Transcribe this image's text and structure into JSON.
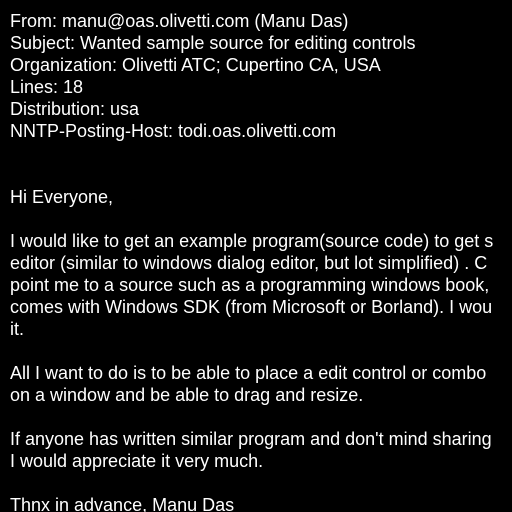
{
  "colors": {
    "background": "#000000",
    "text": "#ffffff"
  },
  "headers": {
    "from": "From: manu@oas.olivetti.com (Manu Das)",
    "subject": "Subject: Wanted sample source for editing controls",
    "organization": "Organization: Olivetti ATC; Cupertino CA, USA",
    "lines": "Lines: 18",
    "distribution": "Distribution: usa",
    "nntp_posting_host": "NNTP-Posting-Host: todi.oas.olivetti.com"
  },
  "body": {
    "greeting": "Hi Everyone,",
    "paragraph1": [
      "I would like to get an example program(source code) to get s",
      "editor (similar to windows dialog editor, but lot simplified) . C",
      "point me to a source such as a programming windows book,",
      "comes with Windows SDK (from Microsoft or Borland). I wou",
      "it."
    ],
    "paragraph2": [
      "All I want to do is to be able to place a edit control or combo",
      "on a window and be able to drag and resize."
    ],
    "paragraph3": [
      "If anyone has written similar program and don't mind sharing",
      "I would appreciate it very much."
    ],
    "signoff": "Thnx in advance, Manu Das"
  }
}
